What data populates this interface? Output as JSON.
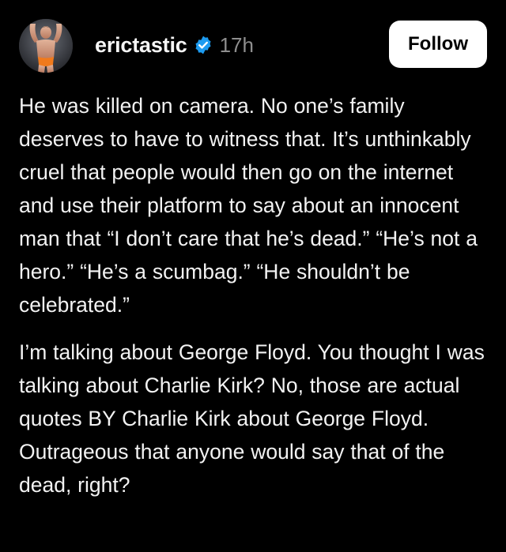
{
  "post": {
    "username": "erictastic",
    "verified_icon": "verified-badge-icon",
    "time": "17h",
    "follow_label": "Follow",
    "avatar_icon": "profile-photo-avatar",
    "paragraphs": [
      "He was killed on camera. No one’s family deserves to have to witness that. It’s unthinkably cruel that people would then go on the internet and use their platform to say about an innocent man that “I don’t care that he’s dead.” “He’s not a hero.” “He’s a scumbag.” “He shouldn’t be celebrated.”",
      "I’m talking about George Floyd. You thought I was talking about Charlie Kirk? No, those are actual quotes BY Charlie Kirk about George Floyd. Outrageous that anyone would say that of the dead, right?"
    ]
  },
  "colors": {
    "background": "#000000",
    "text": "#f2f2f2",
    "muted": "#8e8e8e",
    "verified_blue": "#1d9bf0",
    "button_bg": "#ffffff",
    "button_text": "#000000"
  }
}
